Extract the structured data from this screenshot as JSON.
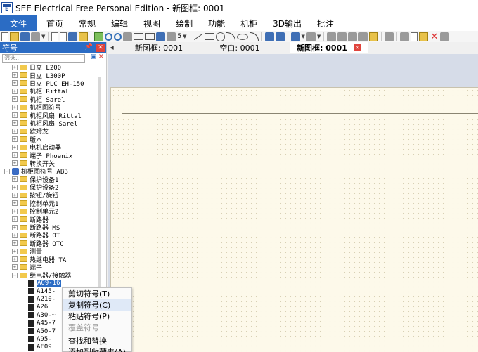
{
  "window": {
    "title": "SEE Electrical Free Personal Edition - 新图框: 0001"
  },
  "ribbon": {
    "file_tab": "文件",
    "tabs": [
      "首页",
      "常规",
      "编辑",
      "视图",
      "绘制",
      "功能",
      "机柜",
      "3D输出",
      "批注"
    ]
  },
  "toolbar": {
    "zoom_grid_value": "5"
  },
  "panel": {
    "title": "符号",
    "filter_placeholder": "筛选...",
    "tree": [
      {
        "label": "日立 L200",
        "level": 1,
        "kind": "folder",
        "expander": "+"
      },
      {
        "label": "日立 L300P",
        "level": 1,
        "kind": "folder",
        "expander": "+"
      },
      {
        "label": "日立 PLC EH-150",
        "level": 1,
        "kind": "folder",
        "expander": "+"
      },
      {
        "label": "机柜 Rittal",
        "level": 1,
        "kind": "folder",
        "expander": "+"
      },
      {
        "label": "机柜 Sarel",
        "level": 1,
        "kind": "folder",
        "expander": "+"
      },
      {
        "label": "机柜图符号",
        "level": 1,
        "kind": "folder",
        "expander": "+"
      },
      {
        "label": "机柜风扇 Rittal",
        "level": 1,
        "kind": "folder",
        "expander": "+"
      },
      {
        "label": "机柜风扇 Sarel",
        "level": 1,
        "kind": "folder",
        "expander": "+"
      },
      {
        "label": "欧姆龙",
        "level": 1,
        "kind": "folder",
        "expander": "+"
      },
      {
        "label": "版本",
        "level": 1,
        "kind": "folder",
        "expander": "+"
      },
      {
        "label": "电机启动器",
        "level": 1,
        "kind": "folder",
        "expander": "+"
      },
      {
        "label": "端子 Phoenix",
        "level": 1,
        "kind": "folder",
        "expander": "+"
      },
      {
        "label": "转换开关",
        "level": 1,
        "kind": "folder",
        "expander": "+"
      },
      {
        "label": "机柜图符号 ABB",
        "level": 0,
        "kind": "library",
        "expander": "−"
      },
      {
        "label": "保护设备1",
        "level": 1,
        "kind": "folder",
        "expander": "+"
      },
      {
        "label": "保护设备2",
        "level": 1,
        "kind": "folder",
        "expander": "+"
      },
      {
        "label": "按钮/旋钮",
        "level": 1,
        "kind": "folder",
        "expander": "+"
      },
      {
        "label": "控制单元1",
        "level": 1,
        "kind": "folder",
        "expander": "+"
      },
      {
        "label": "控制单元2",
        "level": 1,
        "kind": "folder",
        "expander": "+"
      },
      {
        "label": "断路器",
        "level": 1,
        "kind": "folder",
        "expander": "+"
      },
      {
        "label": "断路器 MS",
        "level": 1,
        "kind": "folder",
        "expander": "+"
      },
      {
        "label": "断路器 OT",
        "level": 1,
        "kind": "folder",
        "expander": "+"
      },
      {
        "label": "断路器 OTC",
        "level": 1,
        "kind": "folder",
        "expander": "+"
      },
      {
        "label": "测量",
        "level": 1,
        "kind": "folder",
        "expander": "+"
      },
      {
        "label": "热继电器 TA",
        "level": 1,
        "kind": "folder",
        "expander": "+"
      },
      {
        "label": "端子",
        "level": 1,
        "kind": "folder",
        "expander": "+"
      },
      {
        "label": "继电器/接触器",
        "level": 1,
        "kind": "folder",
        "expander": "−"
      },
      {
        "label": "A09-16",
        "level": 2,
        "kind": "symbol",
        "selected": true
      },
      {
        "label": "A145-",
        "level": 2,
        "kind": "symbol"
      },
      {
        "label": "A210-",
        "level": 2,
        "kind": "symbol"
      },
      {
        "label": "A26",
        "level": 2,
        "kind": "symbol"
      },
      {
        "label": "A30-~",
        "level": 2,
        "kind": "symbol"
      },
      {
        "label": "A45-7",
        "level": 2,
        "kind": "symbol"
      },
      {
        "label": "A50-7",
        "level": 2,
        "kind": "symbol"
      },
      {
        "label": "A95-",
        "level": 2,
        "kind": "symbol"
      },
      {
        "label": "AF09",
        "level": 2,
        "kind": "symbol"
      }
    ]
  },
  "context_menu": {
    "items": [
      {
        "label": "剪切符号(T)",
        "enabled": true,
        "highlighted": false
      },
      {
        "label": "复制符号(C)",
        "enabled": true,
        "highlighted": true
      },
      {
        "label": "粘贴符号(P)",
        "enabled": true,
        "highlighted": false
      },
      {
        "label": "覆盖符号",
        "enabled": false,
        "highlighted": false
      },
      {
        "separator": true
      },
      {
        "label": "查找和替换",
        "enabled": true,
        "highlighted": false
      },
      {
        "label": "添加到收藏夹(A)",
        "enabled": true,
        "highlighted": false
      }
    ]
  },
  "document_tabs": [
    {
      "label": "新图框: 0001",
      "active": false
    },
    {
      "label": "空白: 0001",
      "active": false
    },
    {
      "label": "新图框: 0001",
      "active": true
    }
  ],
  "colors": {
    "accent": "#2b6cc4",
    "close_red": "#e0443c",
    "sheet_background": "#fdf9ea",
    "workspace_background": "#d6dce8"
  }
}
